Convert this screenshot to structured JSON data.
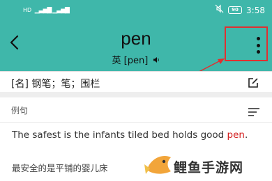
{
  "status_bar": {
    "network_label": "HD",
    "time": "3:58",
    "battery": "90"
  },
  "header": {
    "word": "pen",
    "phonetic_label": "英 [pen]",
    "back_icon": "chevron-left-icon",
    "menu_icon": "more-vertical-icon",
    "speaker_icon": "speaker-icon"
  },
  "definition": {
    "text": "[名] 钢笔；笔；围栏",
    "edit_icon": "edit-icon"
  },
  "examples": {
    "title": "例句",
    "sort_icon": "sort-icon",
    "sentence_part1": "The safest is the infants tiled bed holds good ",
    "sentence_highlight": "pen",
    "sentence_end": ".",
    "translation": "最安全的是平铺的婴儿床"
  },
  "watermark": {
    "text": "鲤鱼手游网"
  },
  "annotation": {
    "color": "#e03030"
  },
  "colors": {
    "header_bg": "#3fb7aa",
    "highlight": "#d42020"
  }
}
